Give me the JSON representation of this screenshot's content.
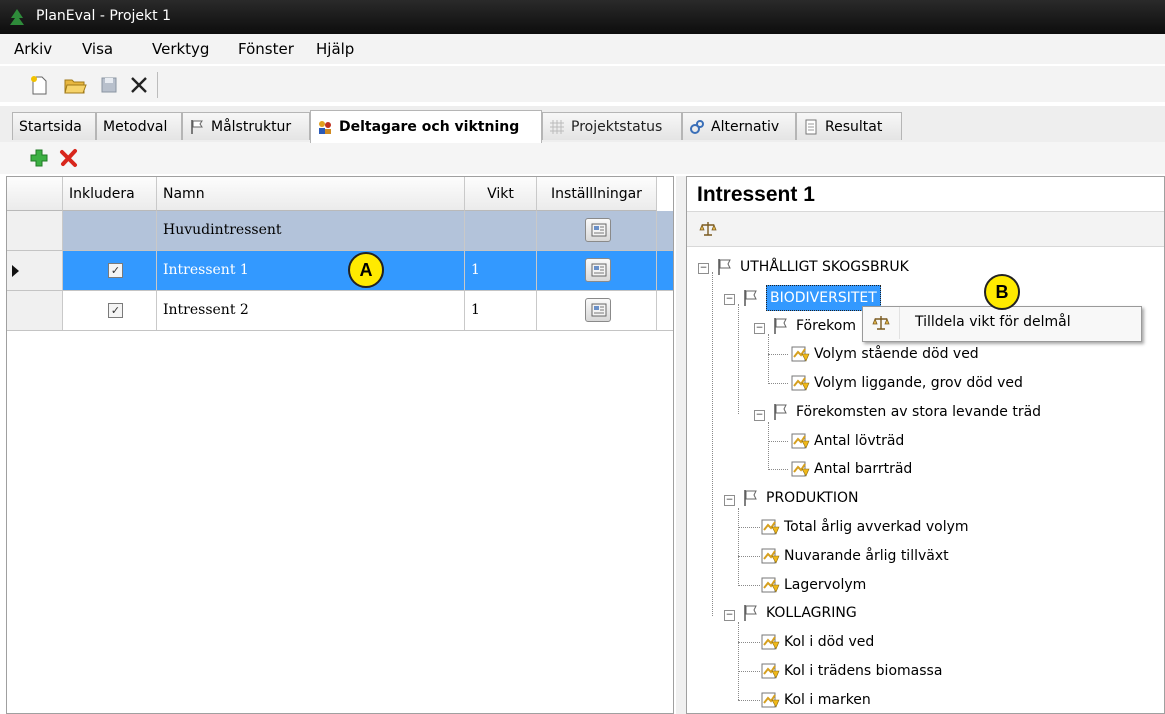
{
  "window": {
    "title": "PlanEval - Projekt 1"
  },
  "menu": [
    "Arkiv",
    "Visa",
    "Verktyg",
    "Fönster",
    "Hjälp"
  ],
  "tabs": [
    {
      "label": "Startsida",
      "icon": ""
    },
    {
      "label": "Metodval",
      "icon": ""
    },
    {
      "label": "Målstruktur",
      "icon": "flag-icon"
    },
    {
      "label": "Deltagare och viktning",
      "icon": "people-icon",
      "active": true
    },
    {
      "label": "Projektstatus",
      "icon": "grid-icon"
    },
    {
      "label": "Alternativ",
      "icon": "gears-icon"
    },
    {
      "label": "Resultat",
      "icon": "document-icon"
    }
  ],
  "grid": {
    "headers": [
      "Inkludera",
      "Namn",
      "Vikt",
      "Inställlningar"
    ],
    "group_row": "Huvudintressent",
    "rows": [
      {
        "name": "Intressent 1",
        "weight": "1",
        "included": true,
        "selected": true
      },
      {
        "name": "Intressent 2",
        "weight": "1",
        "included": true,
        "selected": false
      }
    ]
  },
  "callouts": {
    "a": "A",
    "b": "B"
  },
  "right_panel": {
    "title": "Intressent 1",
    "tree": {
      "root": "UTHÅLLIGT SKOGSBRUK",
      "biodiv": "BIODIVERSITET",
      "forekom1": "Förekom",
      "leaf1": "Volym stående död ved",
      "leaf2": "Volym liggande, grov död ved",
      "forekom2": "Förekomsten av stora levande träd",
      "leaf3": "Antal lövträd",
      "leaf4": "Antal barrträd",
      "produktion": "PRODUKTION",
      "leaf5": "Total årlig avverkad volym",
      "leaf6": "Nuvarande årlig tillväxt",
      "leaf7": "Lagervolym",
      "kollagring": "KOLLAGRING",
      "leaf8": "Kol i död ved",
      "leaf9": "Kol i trädens biomassa",
      "leaf10": "Kol i marken"
    }
  },
  "context_menu": {
    "item": "Tilldela vikt för delmål"
  },
  "colors": {
    "selection": "#3399ff",
    "group_row": "#b3c3da",
    "callout": "#ffea00"
  }
}
